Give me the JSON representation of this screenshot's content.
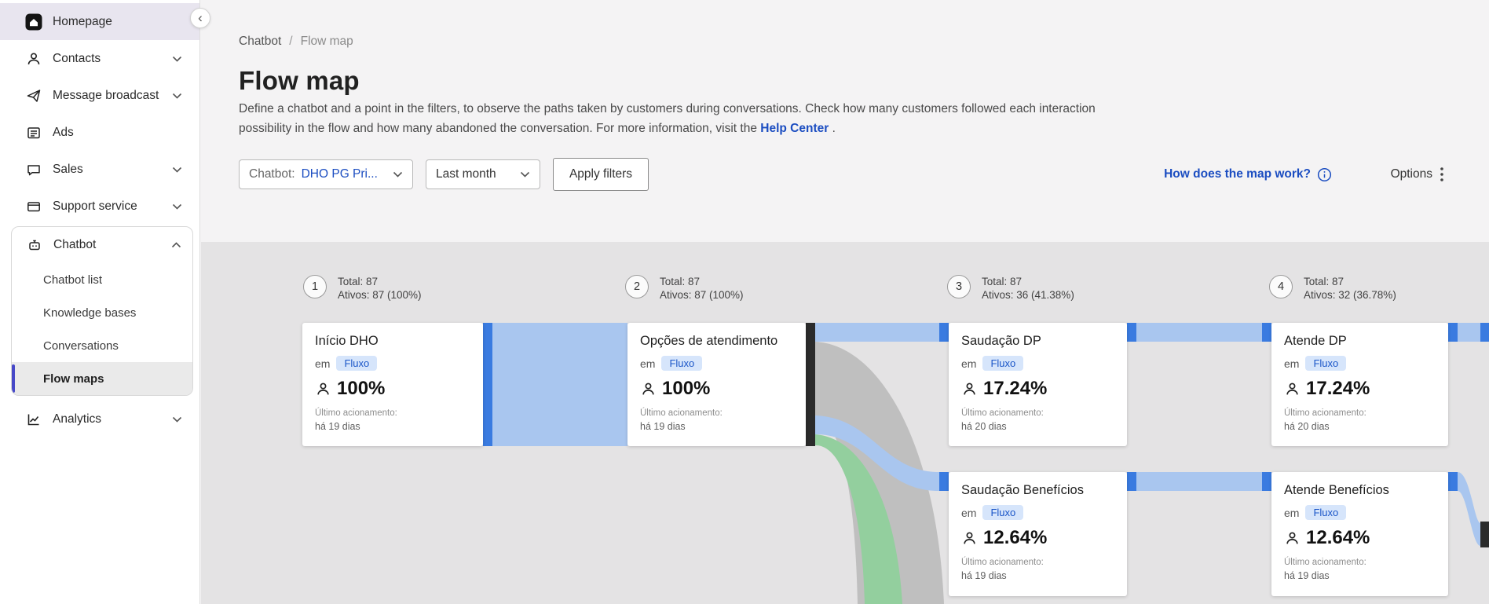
{
  "sidebar": {
    "collapse_glyph": "‹",
    "items": [
      {
        "label": "Homepage"
      },
      {
        "label": "Contacts"
      },
      {
        "label": "Message broadcast"
      },
      {
        "label": "Ads"
      },
      {
        "label": "Sales"
      },
      {
        "label": "Support service"
      },
      {
        "label": "Chatbot"
      },
      {
        "label": "Analytics"
      }
    ],
    "chatbot_sub": [
      {
        "label": "Chatbot list"
      },
      {
        "label": "Knowledge bases"
      },
      {
        "label": "Conversations"
      },
      {
        "label": "Flow maps"
      }
    ]
  },
  "breadcrumb": {
    "level1": "Chatbot",
    "separator": "/",
    "level2": "Flow map"
  },
  "header": {
    "title": "Flow map",
    "description": "Define a chatbot and a point in the filters, to observe the paths taken by customers during conversations. Check how many customers followed each interaction possibility in the flow and how many abandoned the conversation. For more information, visit the",
    "help_link": "Help Center",
    "description_end": "."
  },
  "filters": {
    "chatbot_label": "Chatbot:",
    "chatbot_value": "DHO PG Pri...",
    "period_value": "Last month",
    "apply_button": "Apply filters",
    "map_help_link": "How does the map work?",
    "options_label": "Options"
  },
  "flow": {
    "columns": [
      {
        "number": "1",
        "total": "Total: 87",
        "active": "Ativos: 87 (100%)"
      },
      {
        "number": "2",
        "total": "Total: 87",
        "active": "Ativos: 87 (100%)"
      },
      {
        "number": "3",
        "total": "Total: 87",
        "active": "Ativos: 36 (41.38%)"
      },
      {
        "number": "4",
        "total": "Total: 87",
        "active": "Ativos: 32 (36.78%)"
      }
    ],
    "cards": [
      {
        "title": "Início DHO",
        "em_label": "em",
        "badge": "Fluxo",
        "percent": "100%",
        "last_label": "Último acionamento:",
        "last_value": "há 19 dias"
      },
      {
        "title": "Opções de atendimento",
        "em_label": "em",
        "badge": "Fluxo",
        "percent": "100%",
        "last_label": "Último acionamento:",
        "last_value": "há 19 dias"
      },
      {
        "title": "Saudação DP",
        "em_label": "em",
        "badge": "Fluxo",
        "percent": "17.24%",
        "last_label": "Último acionamento:",
        "last_value": "há 20 dias"
      },
      {
        "title": "Atende DP",
        "em_label": "em",
        "badge": "Fluxo",
        "percent": "17.24%",
        "last_label": "Último acionamento:",
        "last_value": "há 20 dias"
      },
      {
        "title": "Saudação Benefícios",
        "em_label": "em",
        "badge": "Fluxo",
        "percent": "12.64%",
        "last_label": "Último acionamento:",
        "last_value": "há 19 dias"
      },
      {
        "title": "Atende Benefícios",
        "em_label": "em",
        "badge": "Fluxo",
        "percent": "12.64%",
        "last_label": "Último acionamento:",
        "last_value": "há 19 dias"
      }
    ],
    "links": [
      {
        "from": "Início DHO",
        "to": "Opções de atendimento",
        "share": "100%"
      },
      {
        "from": "Opções de atendimento",
        "to": "Saudação DP",
        "share": "17.24%"
      },
      {
        "from": "Opções de atendimento",
        "to": "Saudação Benefícios",
        "share": "12.64%"
      },
      {
        "from": "Saudação DP",
        "to": "Atende DP",
        "share": "17.24%"
      },
      {
        "from": "Saudação Benefícios",
        "to": "Atende Benefícios",
        "share": "12.64%"
      }
    ],
    "colors": {
      "band": "#a9c6ef",
      "connector": "#3a7be0",
      "abandon": "#bdbdbd",
      "terminal": "#2b2b2b",
      "alt_path": "#93cf9e"
    }
  }
}
